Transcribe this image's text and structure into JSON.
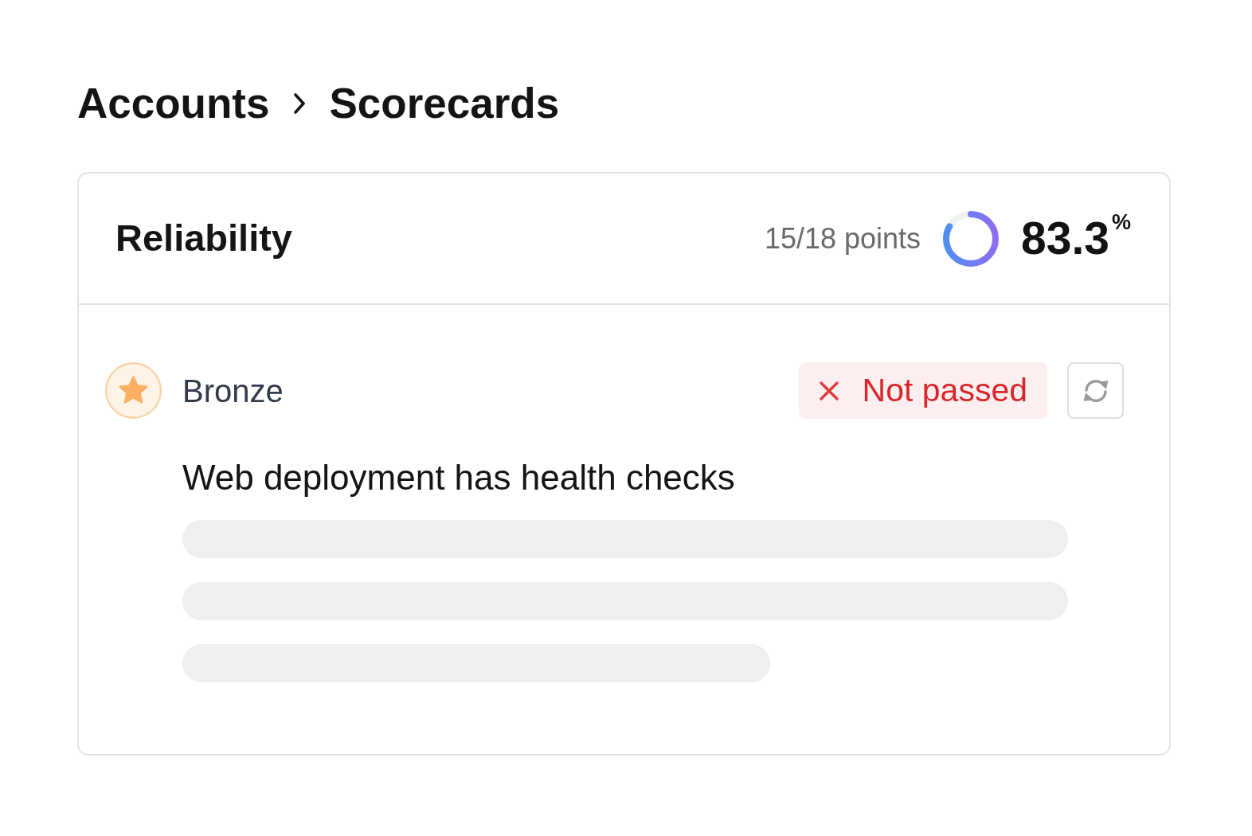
{
  "breadcrumb": [
    {
      "label": "Accounts"
    },
    {
      "label": "Scorecards"
    }
  ],
  "scorecard": {
    "title": "Reliability",
    "points": "15/18 points",
    "level": 0.833,
    "score": "83.3",
    "score_unit": "%"
  },
  "checks": [
    {
      "level_name": "Bronze",
      "passed": false,
      "status_label": "Not passed",
      "title": "Web deployment has health checks",
      "loading": true
    }
  ]
}
